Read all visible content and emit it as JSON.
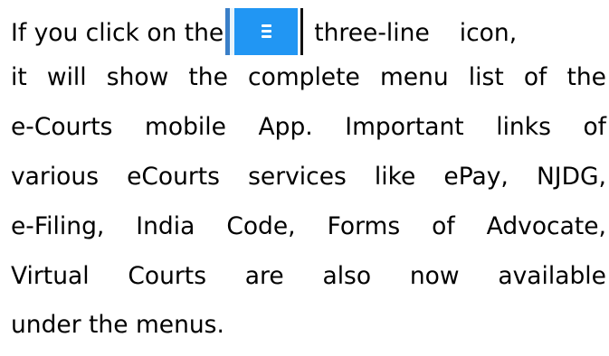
{
  "line1": {
    "before_icon": "If you click on the",
    "after_icon_1": "three-line",
    "after_icon_2": "icon,"
  },
  "icon": {
    "name": "hamburger-menu-icon",
    "color": "#2196f3"
  },
  "line2": [
    "it",
    "will",
    "show",
    "the",
    "complete",
    "menu",
    "list",
    "of",
    "the"
  ],
  "line3": [
    "e-Courts",
    "mobile",
    "App.",
    "Important",
    "links",
    "of"
  ],
  "line4": [
    "various",
    "eCourts",
    "services",
    "like",
    "ePay,",
    "NJDG,"
  ],
  "line5": [
    "e-Filing,",
    "India",
    "Code,",
    "Forms",
    "of",
    "Advocate,"
  ],
  "line6": [
    "Virtual",
    "Courts",
    "are",
    "also",
    "now",
    "available"
  ],
  "line7": "under the menus."
}
